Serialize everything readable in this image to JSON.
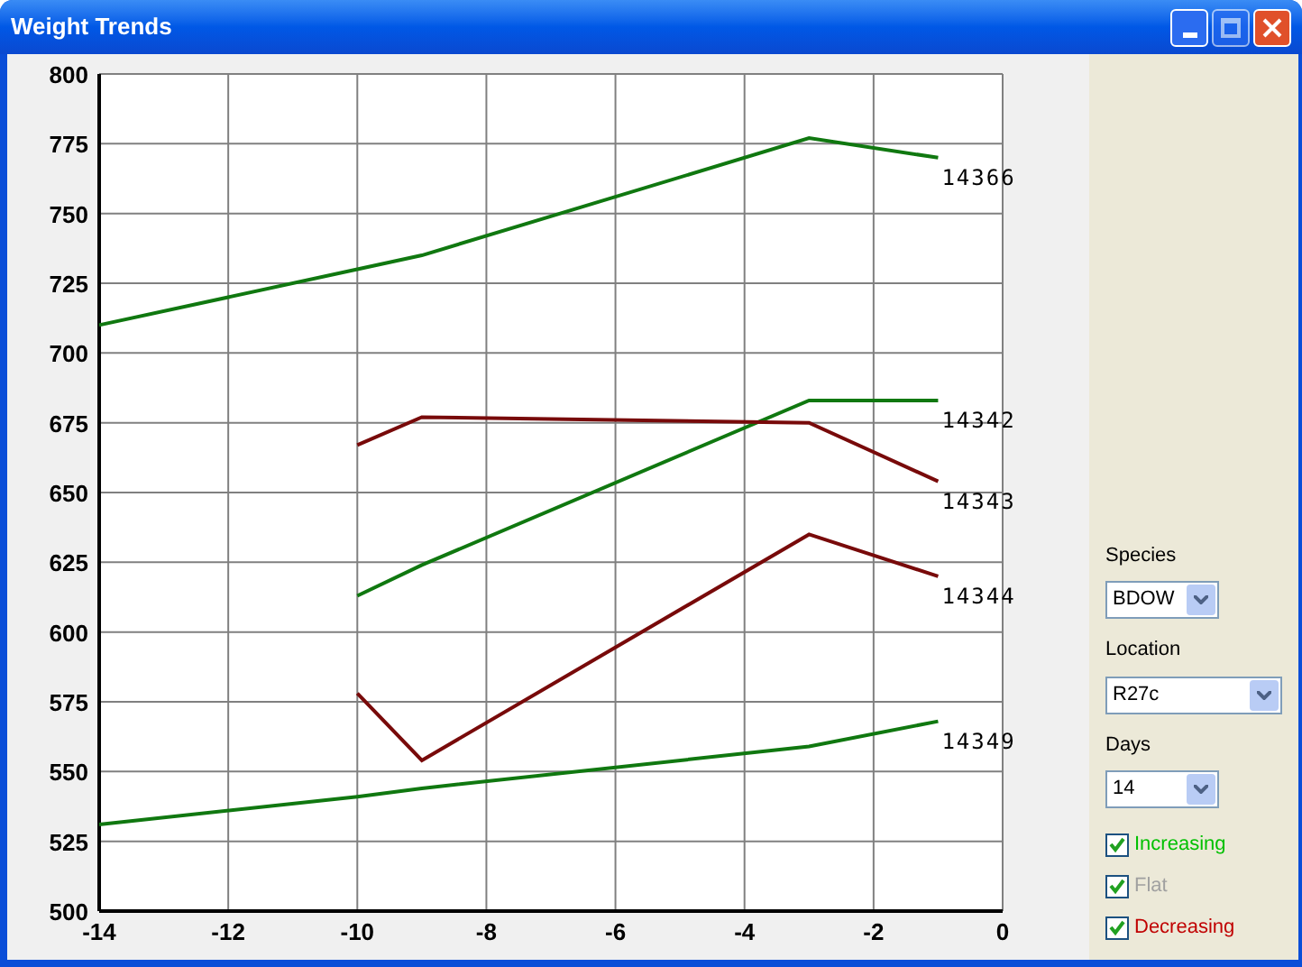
{
  "window": {
    "title": "Weight Trends"
  },
  "chart": {
    "chart_data": {
      "type": "line",
      "grid": true,
      "xlim": [
        -14,
        0
      ],
      "ylim": [
        500,
        800
      ],
      "xticks": [
        -14,
        -12,
        -10,
        -8,
        -6,
        -4,
        -2,
        0
      ],
      "yticks": [
        500,
        525,
        550,
        575,
        600,
        625,
        650,
        675,
        700,
        725,
        750,
        775,
        800
      ],
      "x": [
        -14,
        -10,
        -9,
        -3,
        -1
      ],
      "series": [
        {
          "name": "14366",
          "color": "#107810",
          "values": [
            710,
            730,
            735,
            777,
            770
          ]
        },
        {
          "name": "14342",
          "color": "#107810",
          "values": [
            null,
            613,
            624,
            683,
            683
          ]
        },
        {
          "name": "14343",
          "color": "#780a0a",
          "values": [
            null,
            667,
            677,
            675,
            654
          ]
        },
        {
          "name": "14344",
          "color": "#780a0a",
          "values": [
            null,
            578,
            554,
            635,
            620
          ]
        },
        {
          "name": "14349",
          "color": "#107810",
          "values": [
            531,
            541,
            544,
            559,
            568
          ]
        }
      ]
    }
  },
  "panel": {
    "selects": [
      {
        "label": "Species",
        "value": "BDOW",
        "kind": "short"
      },
      {
        "label": "Location",
        "value": "R27c",
        "kind": "wide"
      },
      {
        "label": "Days",
        "value": "14",
        "kind": "short"
      }
    ],
    "filters": [
      {
        "label": "Increasing",
        "checked": true,
        "color": "#00c000"
      },
      {
        "label": "Flat",
        "checked": true,
        "color": "#a0a0a0"
      },
      {
        "label": "Decreasing",
        "checked": true,
        "color": "#c00000"
      }
    ]
  }
}
